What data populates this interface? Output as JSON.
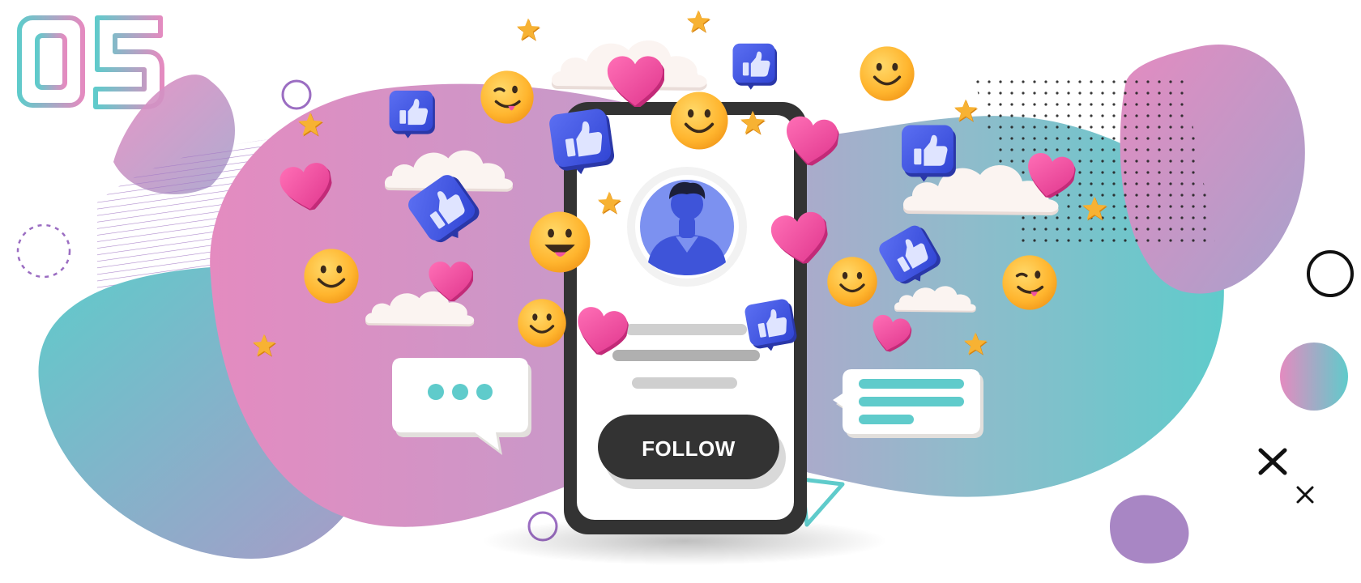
{
  "step": {
    "number": "05"
  },
  "profile_card": {
    "follow_label": "FOLLOW"
  },
  "colors": {
    "pink": "#e48bc0",
    "teal": "#5fcbcb",
    "lavender": "#b7a3d6",
    "heart": "#f0529f",
    "like_blue": "#4a5de8",
    "emoji_yellow": "#ffbf2e",
    "star_orange": "#f5a623",
    "phone_frame": "#333333",
    "button_dark": "#333333"
  },
  "icons": [
    "heart-icon",
    "thumbs-up-icon",
    "smiley-emoji-icon",
    "wink-emoji-icon",
    "star-icon",
    "chat-bubble-icon",
    "user-avatar-icon"
  ]
}
